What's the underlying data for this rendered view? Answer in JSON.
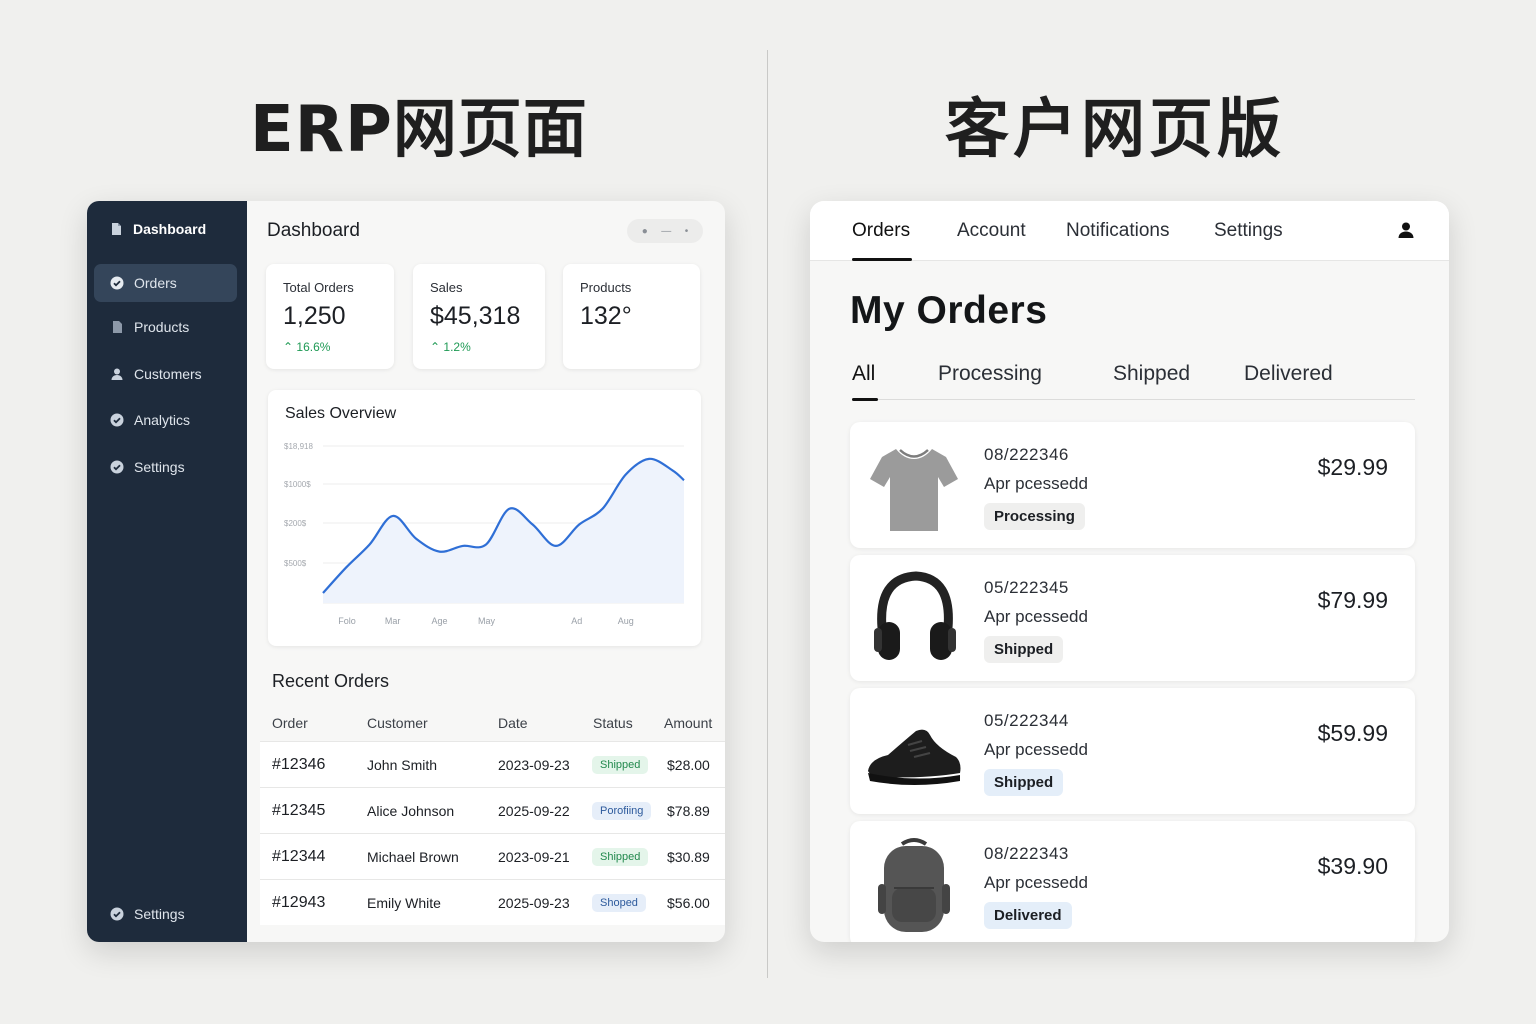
{
  "headings": {
    "erp": "ERP网页面",
    "customer": "客户网页版"
  },
  "erp": {
    "sidebar": {
      "brand": "Dashboard",
      "items": [
        {
          "label": "Orders",
          "icon": "check-circle-icon",
          "active": true
        },
        {
          "label": "Products",
          "icon": "document-icon"
        },
        {
          "label": "Customers",
          "icon": "user-icon"
        },
        {
          "label": "Analytics",
          "icon": "check-circle-icon"
        },
        {
          "label": "Settings",
          "icon": "check-circle-icon"
        }
      ],
      "footer_item": {
        "label": "Settings",
        "icon": "check-circle-icon"
      }
    },
    "title": "Dashboard",
    "stats": [
      {
        "label": "Total Orders",
        "value": "1,250",
        "delta": "16.6%"
      },
      {
        "label": "Sales",
        "value": "$45,318",
        "delta": "1.2%"
      },
      {
        "label": "Products",
        "value": "132°",
        "delta": ""
      }
    ],
    "recent_orders": {
      "title": "Recent Orders",
      "columns": [
        "Order",
        "Customer",
        "Date",
        "Status",
        "Amount"
      ],
      "rows": [
        {
          "order": "#12346",
          "customer": "John Smith",
          "date": "2023-09-23",
          "status": "Shipped",
          "amount": "$28.00"
        },
        {
          "order": "#12345",
          "customer": "Alice Johnson",
          "date": "2025-09-22",
          "status": "Porofiing",
          "amount": "$78.89"
        },
        {
          "order": "#12344",
          "customer": "Michael Brown",
          "date": "2023-09-21",
          "status": "Shipped",
          "amount": "$30.89"
        },
        {
          "order": "#12943",
          "customer": "Emily White",
          "date": "2025-09-23",
          "status": "Shoped",
          "amount": "$56.00"
        }
      ]
    }
  },
  "chart_data": {
    "type": "area",
    "title": "Sales Overview",
    "y_tick_labels": [
      "$18,918",
      "$1000$",
      "$200$",
      "$500$"
    ],
    "x_tick_labels": [
      "Folo",
      "Mar",
      "Age",
      "May",
      "Ad",
      "Aug"
    ],
    "x": [
      0,
      0.5,
      1,
      1.5,
      2,
      2.5,
      3,
      3.5,
      4,
      4.5,
      5,
      5.5,
      6,
      6.5,
      7,
      7.5,
      7.75
    ],
    "values": [
      0.07,
      0.25,
      0.41,
      0.61,
      0.45,
      0.36,
      0.4,
      0.41,
      0.66,
      0.55,
      0.4,
      0.55,
      0.66,
      0.9,
      1.01,
      0.93,
      0.86
    ],
    "ylim": [
      0,
      1.1
    ],
    "grid": true,
    "colors": {
      "line": "#2f6fd6",
      "fill": "#eef3fc"
    }
  },
  "customer": {
    "nav": [
      "Orders",
      "Account",
      "Notifications",
      "Settings"
    ],
    "title": "My Orders",
    "filters": [
      "All",
      "Processing",
      "Shipped",
      "Delivered"
    ],
    "orders": [
      {
        "number": "08/222346",
        "sub": "Apr pcessedd",
        "status": "Processing",
        "price": "$29.99",
        "image": "tshirt-image"
      },
      {
        "number": "05/222345",
        "sub": "Apr pcessedd",
        "status": "Shipped",
        "price": "$79.99",
        "image": "headphones-image"
      },
      {
        "number": "05/222344",
        "sub": "Apr pcessedd",
        "status": "Shipped",
        "price": "$59.99",
        "image": "sneaker-image"
      },
      {
        "number": "08/222343",
        "sub": "Apr pcessedd",
        "status": "Delivered",
        "price": "$39.90",
        "image": "backpack-image"
      }
    ],
    "colors": {
      "badge_grey": "#efefee",
      "badge_blue": "#e4eef9"
    }
  }
}
